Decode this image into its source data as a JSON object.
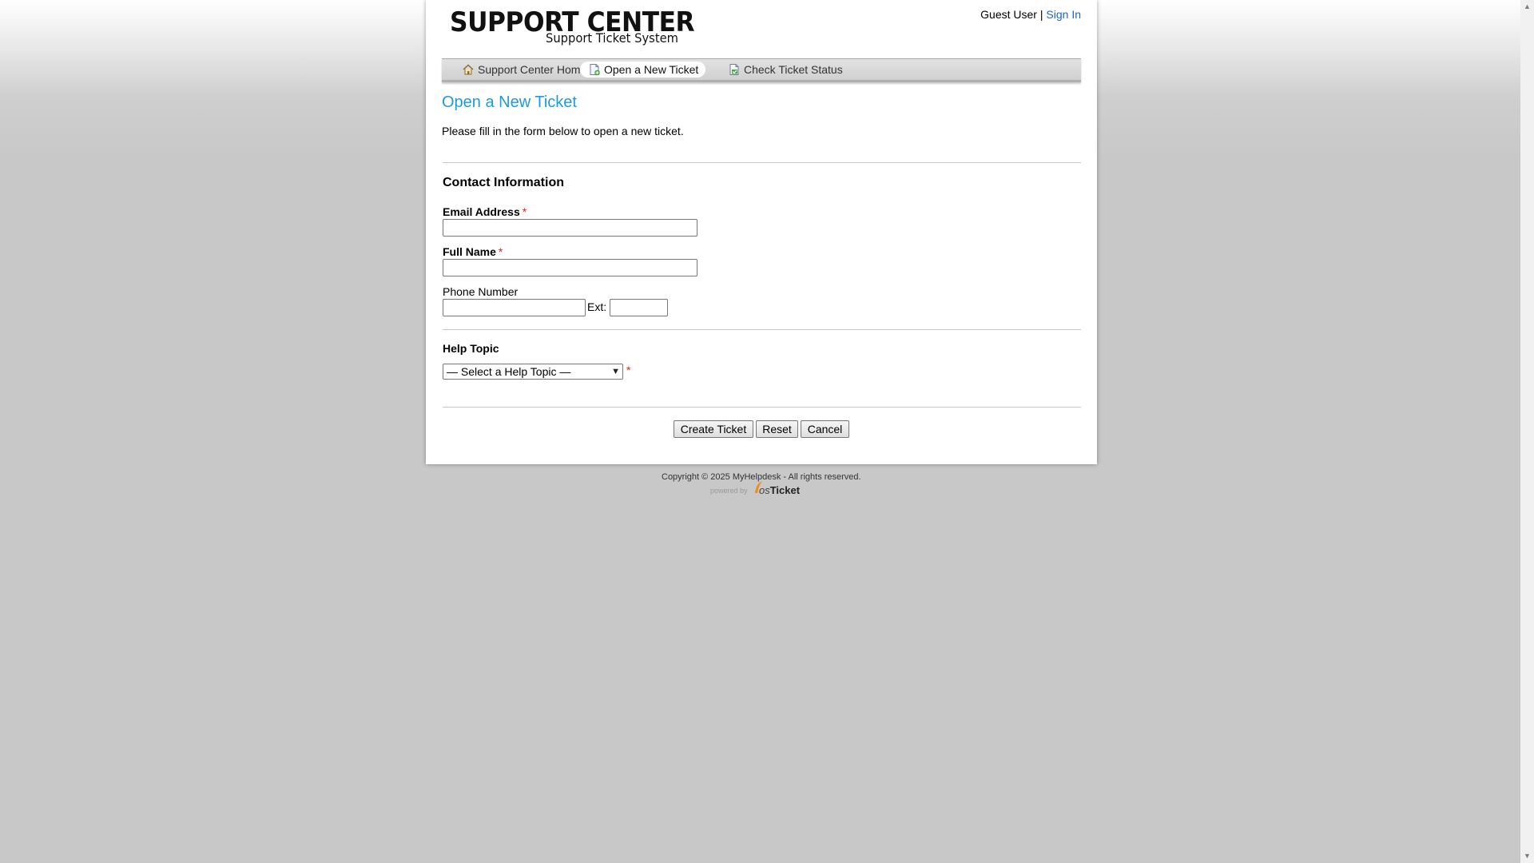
{
  "header": {
    "logo_title": "SUPPORT CENTER",
    "logo_subtitle": "Support Ticket System",
    "user_text": "Guest User",
    "separator": "|",
    "sign_in": "Sign In"
  },
  "nav": {
    "items": [
      {
        "label": "Support Center Home",
        "icon": "home-icon",
        "active": false
      },
      {
        "label": "Open a New Ticket",
        "icon": "new-ticket-icon",
        "active": true
      },
      {
        "label": "Check Ticket Status",
        "icon": "ticket-status-icon",
        "active": false
      }
    ]
  },
  "page": {
    "title": "Open a New Ticket",
    "intro": "Please fill in the form below to open a new ticket."
  },
  "contact": {
    "title": "Contact Information",
    "email_label": "Email Address",
    "email_value": "",
    "name_label": "Full Name",
    "name_value": "",
    "phone_label": "Phone Number",
    "phone_value": "",
    "ext_label": "Ext:",
    "ext_value": "",
    "required_mark": "*"
  },
  "help_topic": {
    "title": "Help Topic",
    "selected": "— Select a Help Topic —",
    "required_mark": "*"
  },
  "buttons": {
    "create": "Create Ticket",
    "reset": "Reset",
    "cancel": "Cancel"
  },
  "footer": {
    "copyright": "Copyright © 2025 MyHelpdesk - All rights reserved.",
    "powered_by": "powered by",
    "brand_os": "os",
    "brand_ticket": "Ticket"
  },
  "colors": {
    "link": "#1a67c2",
    "title": "#1d9ae0",
    "required": "#e02020",
    "background": "#c8c8c8"
  }
}
